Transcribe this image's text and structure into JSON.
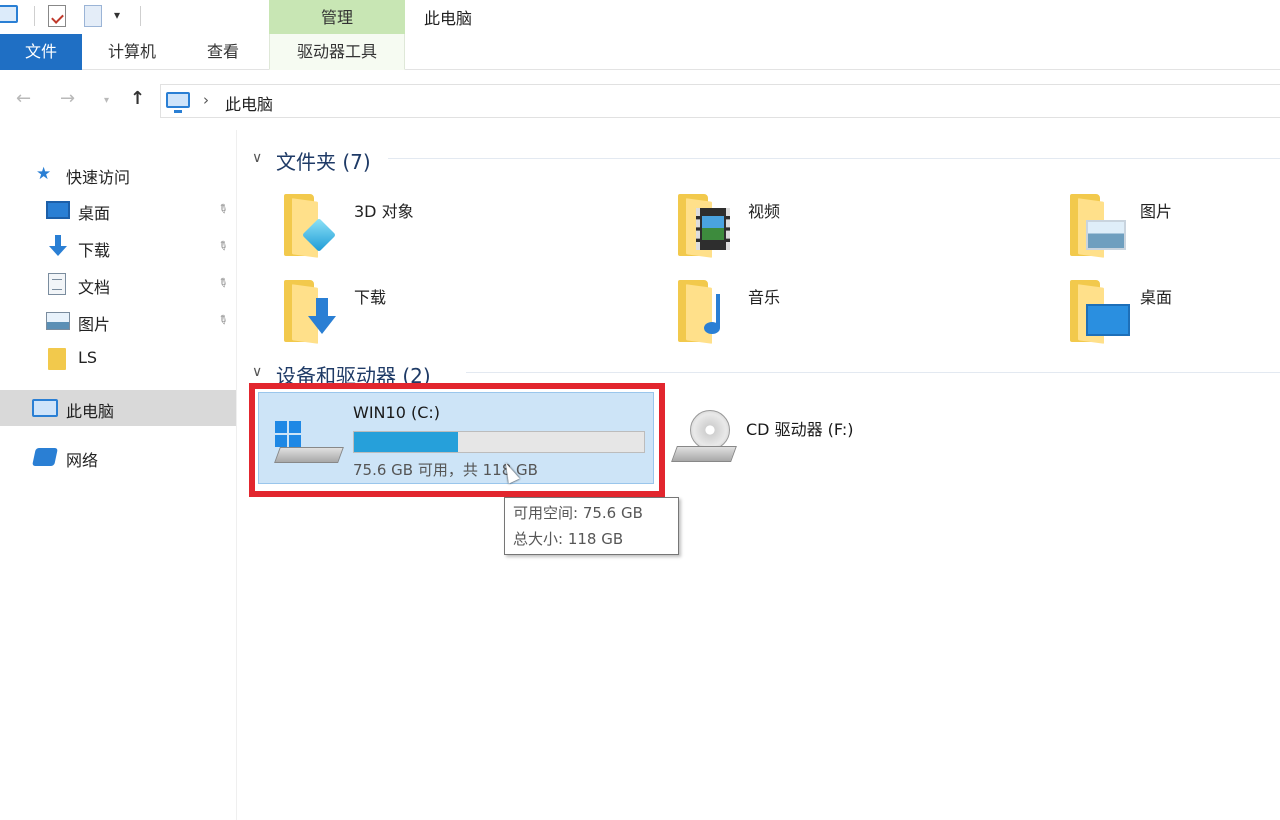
{
  "ribbon": {
    "context_group": "管理",
    "window_title": "此电脑",
    "tabs": {
      "file": "文件",
      "computer": "计算机",
      "view": "查看",
      "drive_tools": "驱动器工具"
    }
  },
  "address": {
    "path": [
      "此电脑"
    ]
  },
  "sidebar": {
    "quick_access": "快速访问",
    "items": [
      {
        "label": "桌面",
        "pinned": true
      },
      {
        "label": "下载",
        "pinned": true
      },
      {
        "label": "文档",
        "pinned": true
      },
      {
        "label": "图片",
        "pinned": true
      },
      {
        "label": "LS",
        "pinned": false
      }
    ],
    "this_pc": "此电脑",
    "network": "网络"
  },
  "folders": {
    "header": "文件夹 (7)",
    "items": [
      {
        "label": "3D 对象",
        "icon": "3d-objects-folder-icon"
      },
      {
        "label": "视频",
        "icon": "videos-folder-icon"
      },
      {
        "label": "图片",
        "icon": "pictures-folder-icon"
      },
      {
        "label": "下载",
        "icon": "downloads-folder-icon"
      },
      {
        "label": "音乐",
        "icon": "music-folder-icon"
      },
      {
        "label": "桌面",
        "icon": "desktop-folder-icon"
      }
    ]
  },
  "devices": {
    "header": "设备和驱动器 (2)",
    "drive_c": {
      "name": "WIN10 (C:)",
      "free_text": "75.6 GB 可用，共 118 GB",
      "used_fraction": 0.36
    },
    "drive_f": {
      "name": "CD 驱动器 (F:)"
    }
  },
  "tooltip": {
    "line1": "可用空间: 75.6 GB",
    "line2": "总大小: 118 GB"
  },
  "colors": {
    "accent": "#1f6fc4",
    "selection": "#cde4f7",
    "highlight_box": "#e2262e",
    "usage_bar": "#26a0da"
  }
}
